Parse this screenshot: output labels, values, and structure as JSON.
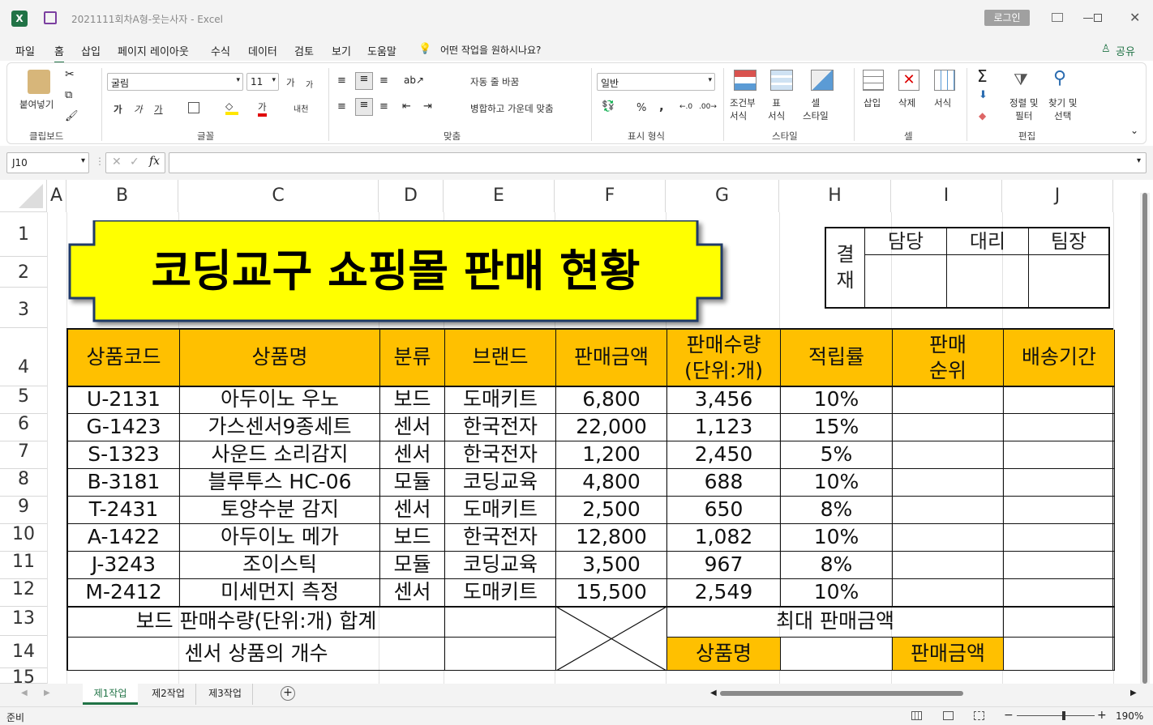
{
  "window": {
    "title": "2021111회차A형-웃는사자  -  Excel",
    "login": "로그인",
    "share": "공유"
  },
  "menu": [
    "파일",
    "홈",
    "삽입",
    "페이지 레이아웃",
    "수식",
    "데이터",
    "검토",
    "보기",
    "도움말"
  ],
  "tell_me": "어떤 작업을 원하시나요?",
  "ribbon": {
    "paste": "붙여넣기",
    "clipboard": "클립보드",
    "font_name": "굴림",
    "font_size": "11",
    "font_group": "글꼴",
    "bold": "가",
    "italic": "가",
    "underline": "가",
    "font_color": "가",
    "phonetic": "내천",
    "grow": "가",
    "shrink": "가",
    "wrap": "자동 줄 바꿈",
    "merge": "병합하고 가운데 맞춤",
    "align_group": "맞춤",
    "number_format": "일반",
    "percent": "%",
    "comma": ",",
    "number_group": "표시 형식",
    "cond1": "조건부",
    "cond2": "서식",
    "table1": "표",
    "table2": "서식",
    "cellstyle1": "셀",
    "cellstyle2": "스타일",
    "style_group": "스타일",
    "insert": "삽입",
    "delete": "삭제",
    "format": "서식",
    "cells_group": "셀",
    "sort1": "정렬 및",
    "sort2": "필터",
    "find1": "찾기 및",
    "find2": "선택",
    "edit_group": "편집"
  },
  "name_box": "J10",
  "formula": "",
  "columns": [
    "A",
    "B",
    "C",
    "D",
    "E",
    "F",
    "G",
    "H",
    "I",
    "J"
  ],
  "rows": [
    "1",
    "2",
    "3",
    "4",
    "5",
    "6",
    "7",
    "8",
    "9",
    "10",
    "11",
    "12",
    "13",
    "14",
    "15"
  ],
  "sheet": {
    "title": "코딩교구 쇼핑몰 판매 현황",
    "approval": {
      "label1": "결",
      "label2": "재",
      "c1": "담당",
      "c2": "대리",
      "c3": "팀장"
    },
    "headers": [
      "상품코드",
      "상품명",
      "분류",
      "브랜드",
      "판매금액",
      "판매수량",
      "(단위:개)",
      "적립률",
      "판매",
      "순위",
      "배송기간"
    ],
    "data": [
      [
        "U-2131",
        "아두이노 우노",
        "보드",
        "도매키트",
        "6,800",
        "3,456",
        "10%"
      ],
      [
        "G-1423",
        "가스센서9종세트",
        "센서",
        "한국전자",
        "22,000",
        "1,123",
        "15%"
      ],
      [
        "S-1323",
        "사운드 소리감지",
        "센서",
        "한국전자",
        "1,200",
        "2,450",
        "5%"
      ],
      [
        "B-3181",
        "블루투스 HC-06",
        "모듈",
        "코딩교육",
        "4,800",
        "688",
        "10%"
      ],
      [
        "T-2431",
        "토양수분 감지",
        "센서",
        "도매키트",
        "2,500",
        "650",
        "8%"
      ],
      [
        "A-1422",
        "아두이노 메가",
        "보드",
        "한국전자",
        "12,800",
        "1,082",
        "10%"
      ],
      [
        "J-3243",
        "조이스틱",
        "모듈",
        "코딩교육",
        "3,500",
        "967",
        "8%"
      ],
      [
        "M-2412",
        "미세먼지 측정",
        "센서",
        "도매키트",
        "15,500",
        "2,549",
        "10%"
      ]
    ],
    "summary": {
      "r13": "보드 판매수량(단위:개) 합계",
      "r14": "센서 상품의 개수",
      "max_label": "최대 판매금액",
      "name_label": "상품명",
      "amount_label": "판매금액"
    }
  },
  "sheet_tabs": [
    "제1작업",
    "제2작업",
    "제3작업"
  ],
  "status": {
    "ready": "준비",
    "zoom": "190%"
  },
  "colors": {
    "header": "#ffc000",
    "title_bg": "#ffff00",
    "excel_green": "#217346"
  }
}
